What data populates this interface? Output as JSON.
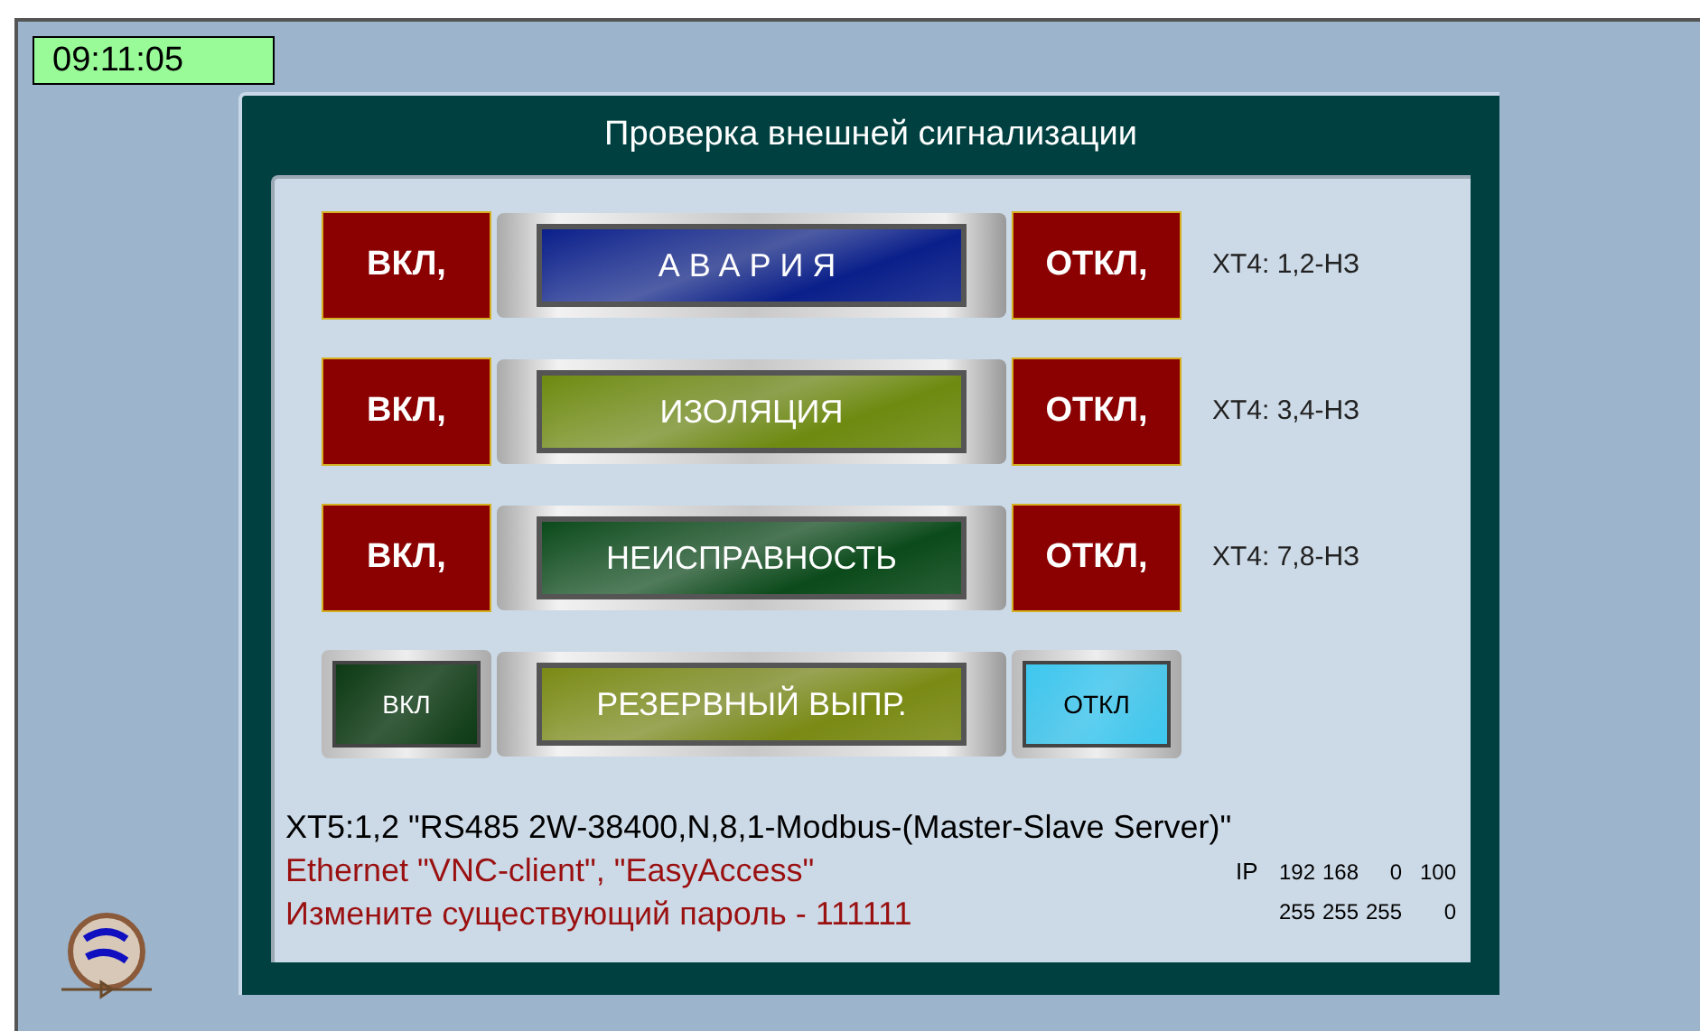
{
  "clock": "09:11:05",
  "panel": {
    "title": "Проверка внешней сигнализации",
    "rows": [
      {
        "on_button": {
          "label": "ВКЛ,",
          "kind": "flat"
        },
        "indicator": {
          "label": "АВАРИЯ",
          "color": "#0a1f8a",
          "spaced": true
        },
        "off_button": {
          "label": "ОТКЛ,",
          "kind": "flat"
        },
        "terminal": "XT4: 1,2-НЗ"
      },
      {
        "on_button": {
          "label": "ВКЛ,",
          "kind": "flat"
        },
        "indicator": {
          "label": "ИЗОЛЯЦИЯ",
          "color": "#6e8a10",
          "spaced": false
        },
        "off_button": {
          "label": "ОТКЛ,",
          "kind": "flat"
        },
        "terminal": "XT4: 3,4-НЗ"
      },
      {
        "on_button": {
          "label": "ВКЛ,",
          "kind": "flat"
        },
        "indicator": {
          "label": "НЕИСПРАВНОСТЬ",
          "color": "#0b4a1a",
          "spaced": false
        },
        "off_button": {
          "label": "ОТКЛ,",
          "kind": "flat"
        },
        "terminal": "XT4: 7,8-НЗ"
      },
      {
        "on_button": {
          "label": "ВКЛ",
          "kind": "glass",
          "color": "#0d3a14"
        },
        "indicator": {
          "label": "РЕЗЕРВНЫЙ ВЫПР.",
          "color": "#7a8a14",
          "spaced": false
        },
        "off_button": {
          "label": "ОТКЛ",
          "kind": "glass",
          "color": "#3ec8f0"
        }
      }
    ],
    "info": [
      "XT5:1,2 \"RS485 2W-38400,N,8,1-Modbus-(Master-Slave Server)\"",
      "Ethernet \"VNC-client\", \"EasyAccess\"",
      "Измените существующий пароль - 111111"
    ],
    "ip": {
      "label": "IP",
      "address": [
        "192",
        "168",
        "0",
        "100"
      ],
      "mask": [
        "255",
        "255",
        "255",
        "0"
      ]
    }
  }
}
